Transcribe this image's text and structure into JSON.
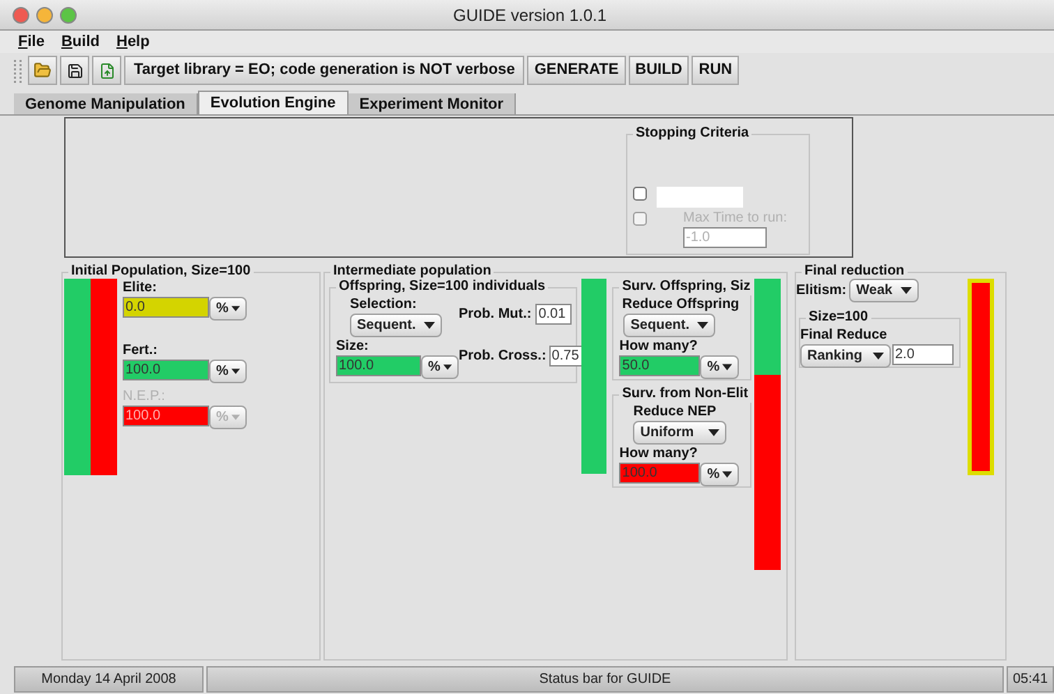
{
  "window": {
    "title": "GUIDE version 1.0.1"
  },
  "menu": [
    {
      "label": "File"
    },
    {
      "label": "Build"
    },
    {
      "label": "Help"
    }
  ],
  "toolbar": {
    "status": "Target library = EO; code generation is NOT verbose",
    "buttons": [
      "GENERATE",
      "BUILD",
      "RUN"
    ]
  },
  "tabs": [
    {
      "label": "Genome Manipulation",
      "selected": false
    },
    {
      "label": "Evolution Engine",
      "selected": true
    },
    {
      "label": "Experiment Monitor",
      "selected": false
    }
  ],
  "stopping_criteria": {
    "title": "Stopping Criteria",
    "options": [
      {
        "checked": false,
        "disabled": false
      },
      {
        "checked": false,
        "disabled": true,
        "label": "Max Time to run:",
        "value": "-1.0"
      }
    ]
  },
  "initial_population": {
    "title": "Initial Population, Size=100",
    "fields": [
      {
        "label": "Elite:",
        "value": "0.0",
        "unit": "%",
        "color": "#d4d400",
        "disabled": false
      },
      {
        "label": "Fert.:",
        "value": "100.0",
        "unit": "%",
        "color": "#22cc66",
        "disabled": false
      },
      {
        "label": "N.E.P.:",
        "value": "100.0",
        "unit": "%",
        "color": "#ff0000",
        "disabled": true
      }
    ]
  },
  "intermediate_population": {
    "title": "Intermediate population",
    "offspring": {
      "title": "Offspring, Size=100 individuals",
      "selection_label": "Selection:",
      "selection": "Sequent.",
      "size_label": "Size:",
      "size": {
        "value": "100.0",
        "unit": "%",
        "color": "#22cc66"
      },
      "prob_mut_label": "Prob. Mut.:",
      "prob_mut": "0.01",
      "prob_cross_label": "Prob. Cross.:",
      "prob_cross": "0.75"
    },
    "survivors": [
      {
        "title": "Surv. Offspring, Siz",
        "reduce_label": "Reduce Offspring",
        "reduce": "Sequent.",
        "how_many_label": "How many?",
        "value": "50.0",
        "unit": "%",
        "color": "#22cc66"
      },
      {
        "title": "Surv. from Non-Elit",
        "reduce_label": "Reduce NEP",
        "reduce": "Uniform",
        "how_many_label": "How many?",
        "value": "100.0",
        "unit": "%",
        "color": "#ff0000"
      }
    ],
    "split_bar": {
      "level": 0.33
    }
  },
  "final_reduction": {
    "title": "Final reduction",
    "elitism_label": "Elitism:",
    "elitism": "Weak",
    "size_title": "Size=100",
    "reduce_label": "Final Reduce",
    "reduce": "Ranking",
    "value": "2.0"
  },
  "status_bar": {
    "date": "Monday 14 April 2008",
    "message": "Status bar for GUIDE",
    "time": "05:41"
  }
}
